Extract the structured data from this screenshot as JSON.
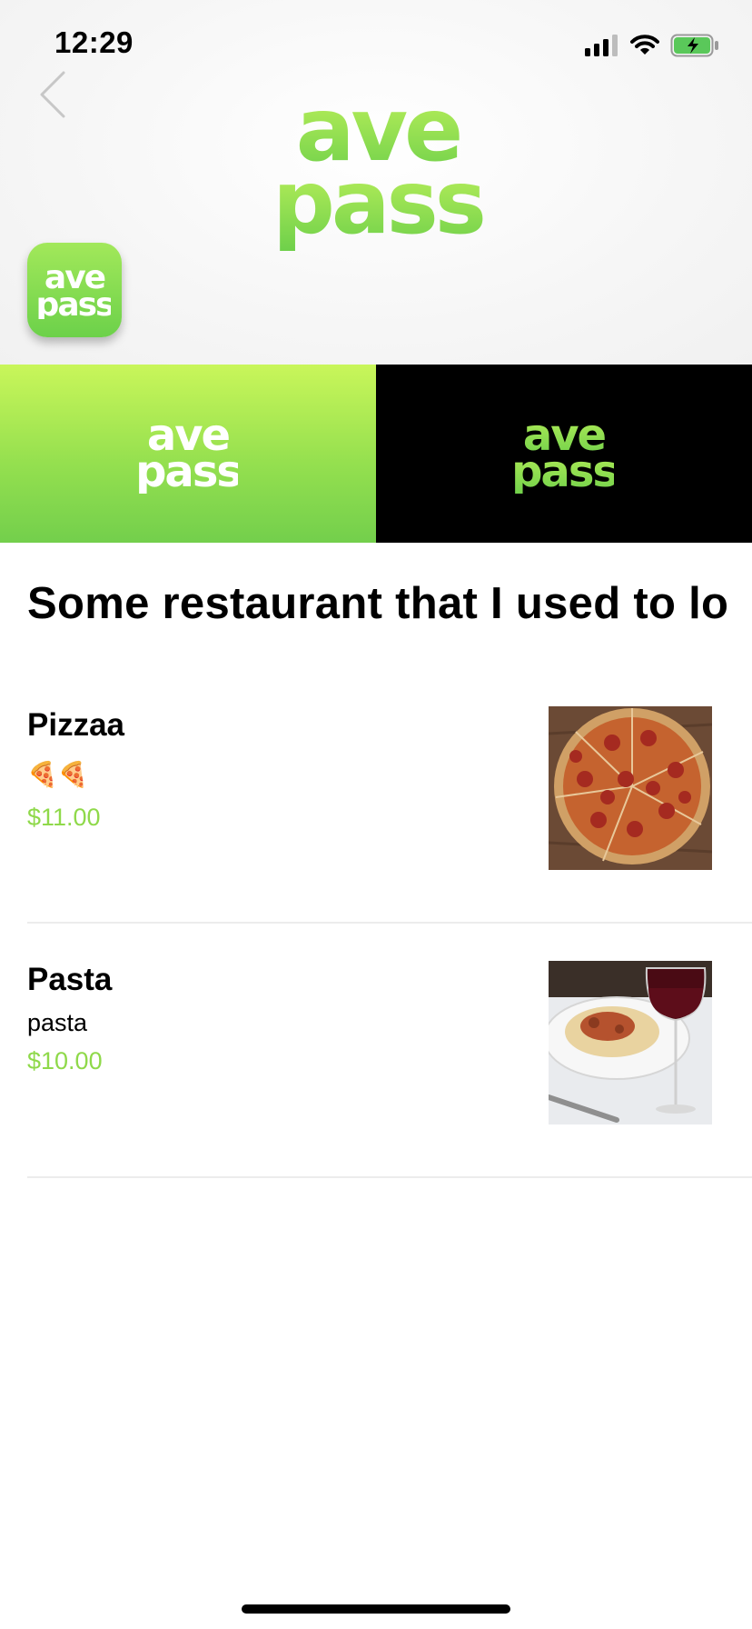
{
  "status_bar": {
    "time": "12:29",
    "icons": [
      "cellular-signal-icon",
      "wifi-icon",
      "battery-charging-icon"
    ]
  },
  "header": {
    "back_icon": "chevron-left-icon",
    "logo_text": [
      "ave",
      "pass"
    ]
  },
  "banner": {
    "left_logo_text": [
      "ave",
      "pass"
    ],
    "right_logo_text": [
      "ave",
      "pass"
    ]
  },
  "restaurant": {
    "title": "Some restaurant that I used to love"
  },
  "menu": {
    "items": [
      {
        "name": "Pizzaa",
        "description": "🍕🍕",
        "price": "$11.00",
        "image": "pepperoni-pizza-photo"
      },
      {
        "name": "Pasta",
        "description": "pasta",
        "price": "$10.00",
        "image": "pasta-and-wine-photo"
      }
    ]
  },
  "colors": {
    "brand_green": "#8fd94a",
    "brand_lime": "#c9f65a",
    "banner_dark": "#000000"
  }
}
